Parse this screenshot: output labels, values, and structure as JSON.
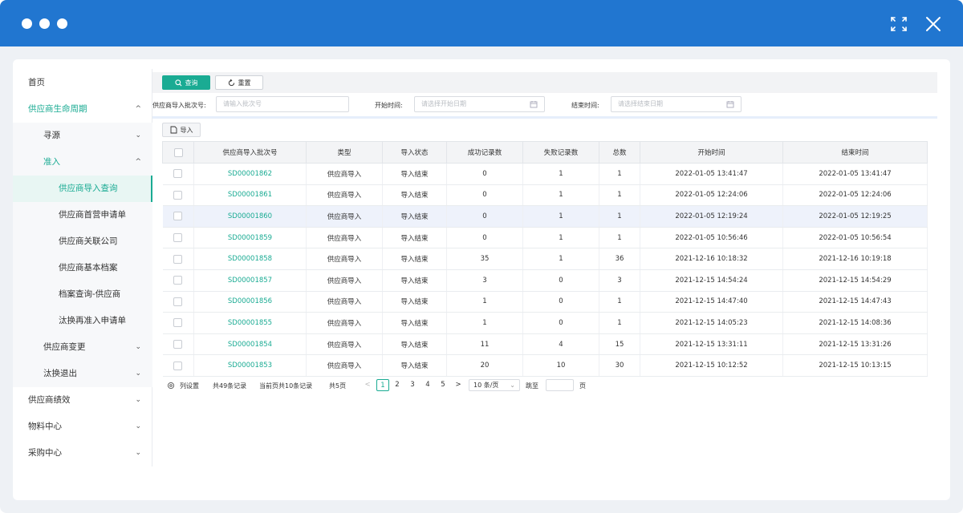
{
  "window": {
    "controls": [
      "dot",
      "dot",
      "dot"
    ],
    "expand_icon": "expand-icon",
    "close_icon": "close-icon"
  },
  "sidebar": {
    "items": [
      {
        "label": "首页",
        "level": 0,
        "chevron": ""
      },
      {
        "label": "供应商生命周期",
        "level": 0,
        "chevron": "^",
        "state": "open"
      },
      {
        "label": "寻源",
        "level": 1,
        "chevron": "⌄"
      },
      {
        "label": "准入",
        "level": 1,
        "chevron": "^",
        "state": "open"
      },
      {
        "label": "供应商导入查询",
        "level": 2,
        "chevron": "",
        "state": "active"
      },
      {
        "label": "供应商首营申请单",
        "level": 2,
        "chevron": ""
      },
      {
        "label": "供应商关联公司",
        "level": 2,
        "chevron": ""
      },
      {
        "label": "供应商基本档案",
        "level": 2,
        "chevron": ""
      },
      {
        "label": "档案查询-供应商",
        "level": 2,
        "chevron": ""
      },
      {
        "label": "汰换再准入申请单",
        "level": 2,
        "chevron": ""
      },
      {
        "label": "供应商变更",
        "level": 1,
        "chevron": "⌄"
      },
      {
        "label": "汰换退出",
        "level": 1,
        "chevron": "⌄"
      },
      {
        "label": "供应商绩效",
        "level": 0,
        "chevron": "⌄"
      },
      {
        "label": "物料中心",
        "level": 0,
        "chevron": "⌄"
      },
      {
        "label": "采购中心",
        "level": 0,
        "chevron": "⌄"
      }
    ]
  },
  "toolbar": {
    "query_label": "查询",
    "reset_label": "重置"
  },
  "filters": {
    "batch_label": "供应商导入批次号:",
    "batch_placeholder": "请输入批次号",
    "start_label": "开始时间:",
    "start_placeholder": "请选择开始日期",
    "end_label": "结束时间:",
    "end_placeholder": "请选择结束日期"
  },
  "import_label": "导入",
  "table": {
    "columns": [
      "供应商导入批次号",
      "类型",
      "导入状态",
      "成功记录数",
      "失败记录数",
      "总数",
      "开始时间",
      "结束时间"
    ],
    "rows": [
      [
        "SD00001862",
        "供应商导入",
        "导入结束",
        "0",
        "1",
        "1",
        "2022-01-05 13:41:47",
        "2022-01-05 13:41:47"
      ],
      [
        "SD00001861",
        "供应商导入",
        "导入结束",
        "0",
        "1",
        "1",
        "2022-01-05 12:24:06",
        "2022-01-05 12:24:06"
      ],
      [
        "SD00001860",
        "供应商导入",
        "导入结束",
        "0",
        "1",
        "1",
        "2022-01-05 12:19:24",
        "2022-01-05 12:19:25"
      ],
      [
        "SD00001859",
        "供应商导入",
        "导入结束",
        "0",
        "1",
        "1",
        "2022-01-05 10:56:46",
        "2022-01-05 10:56:54"
      ],
      [
        "SD00001858",
        "供应商导入",
        "导入结束",
        "35",
        "1",
        "36",
        "2021-12-16 10:18:32",
        "2021-12-16 10:19:18"
      ],
      [
        "SD00001857",
        "供应商导入",
        "导入结束",
        "3",
        "0",
        "3",
        "2021-12-15 14:54:24",
        "2021-12-15 14:54:29"
      ],
      [
        "SD00001856",
        "供应商导入",
        "导入结束",
        "1",
        "0",
        "1",
        "2021-12-15 14:47:40",
        "2021-12-15 14:47:43"
      ],
      [
        "SD00001855",
        "供应商导入",
        "导入结束",
        "1",
        "0",
        "1",
        "2021-12-15 14:05:23",
        "2021-12-15 14:08:36"
      ],
      [
        "SD00001854",
        "供应商导入",
        "导入结束",
        "11",
        "4",
        "15",
        "2021-12-15 13:31:11",
        "2021-12-15 13:31:26"
      ],
      [
        "SD00001853",
        "供应商导入",
        "导入结束",
        "20",
        "10",
        "30",
        "2021-12-15 10:12:52",
        "2021-12-15 10:13:15"
      ]
    ],
    "highlighted_row": 2
  },
  "pager": {
    "column_settings": "列设置",
    "total": "共49条记录",
    "current_page_info": "当前页共10条记录",
    "pages_total": "共5页",
    "prev": "<",
    "pages": [
      "1",
      "2",
      "3",
      "4",
      "5"
    ],
    "current_page": "1",
    "next": ">",
    "page_size": "10 条/页",
    "jump_label": "跳至",
    "page_suffix": "页"
  },
  "colors": {
    "titlebar": "#2176d0",
    "accent": "#1aab93"
  }
}
